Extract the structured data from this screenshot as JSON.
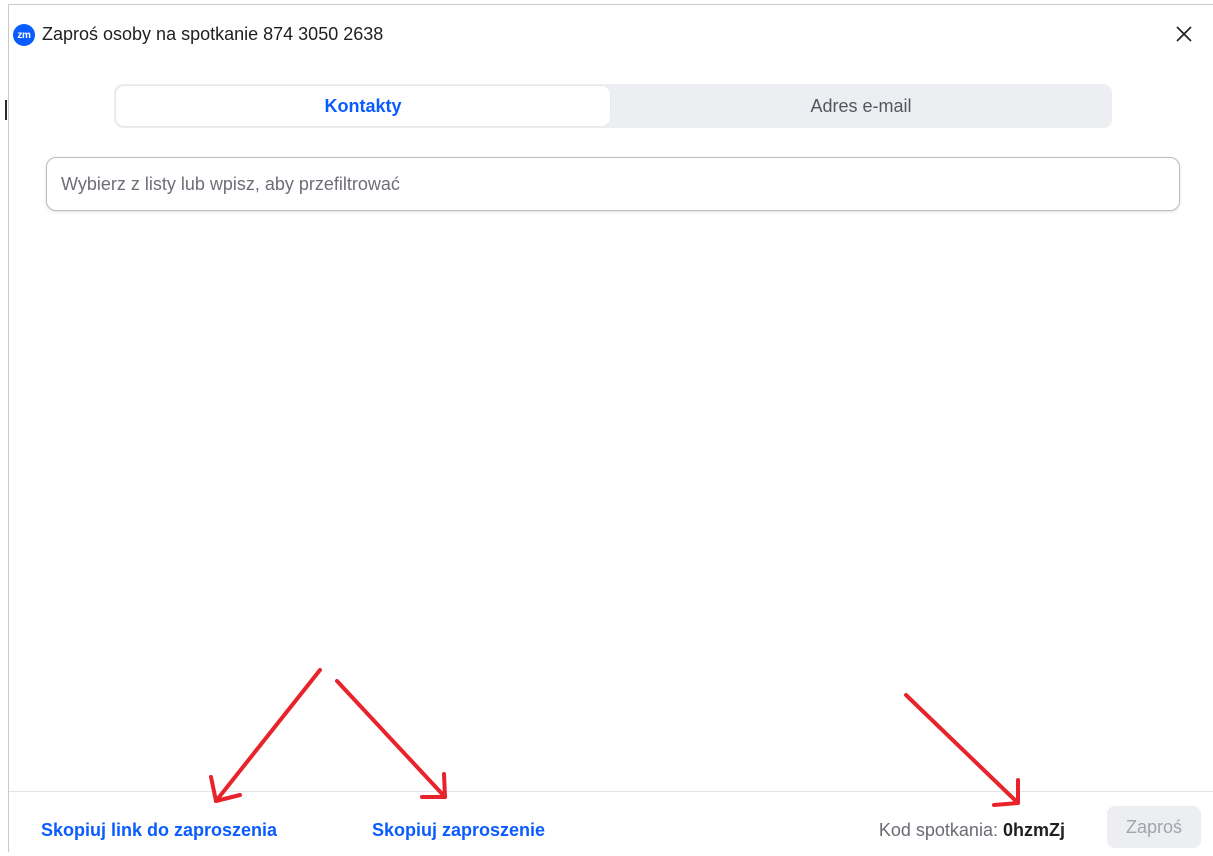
{
  "window": {
    "logo_text": "zm",
    "title": "Zaproś osoby na spotkanie 874 3050 2638"
  },
  "tabs": {
    "contacts": "Kontakty",
    "email": "Adres e-mail"
  },
  "search": {
    "placeholder": "Wybierz z listy lub wpisz, aby przefiltrować",
    "value": ""
  },
  "footer": {
    "copy_link": "Skopiuj link do zaproszenia",
    "copy_invitation": "Skopiuj zaproszenie",
    "meeting_code_label": "Kod spotkania:",
    "meeting_code": "0hzmZj",
    "invite_button": "Zaproś"
  },
  "colors": {
    "accent": "#0b5cff",
    "annotation": "#e8232b"
  },
  "icons": {
    "close": "close-icon",
    "logo": "zoom-logo-icon"
  }
}
